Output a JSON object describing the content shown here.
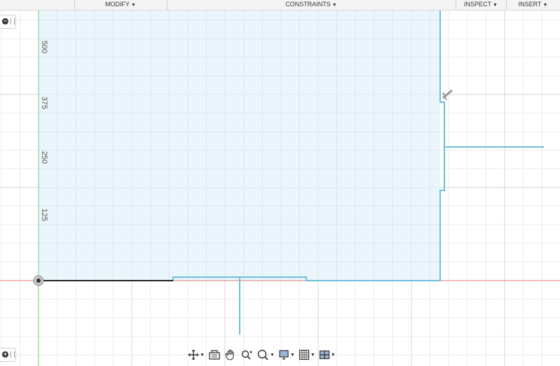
{
  "toolbar": {
    "items": [
      {
        "label": "MODIFY"
      },
      {
        "label": "CONSTRAINTS"
      },
      {
        "label": "INSPECT"
      },
      {
        "label": "INSERT"
      }
    ]
  },
  "canvas": {
    "axis_ticks": [
      "500",
      "375",
      "250",
      "125"
    ],
    "colors": {
      "grid": "#e3e3e3",
      "fill": "#e8f4fb",
      "profile": "#6bbfd6",
      "x_axis": "#e07a7a",
      "y_axis": "#6fcf6f",
      "line": "#222222"
    }
  },
  "side_controls": {
    "top_icon": "minus-circle-icon",
    "bottom_icon": "plus-circle-icon"
  },
  "navbar": {
    "buttons": [
      {
        "icon": "orbit-icon",
        "caret": true
      },
      {
        "icon": "look-at-icon",
        "caret": false
      },
      {
        "icon": "pan-hand-icon",
        "caret": false
      },
      {
        "icon": "zoom-icon",
        "caret": false
      },
      {
        "icon": "fit-zoom-icon",
        "caret": true
      },
      {
        "icon": "display-settings-icon",
        "caret": true
      },
      {
        "icon": "grid-settings-icon",
        "caret": true
      },
      {
        "icon": "viewports-icon",
        "caret": true
      }
    ]
  }
}
